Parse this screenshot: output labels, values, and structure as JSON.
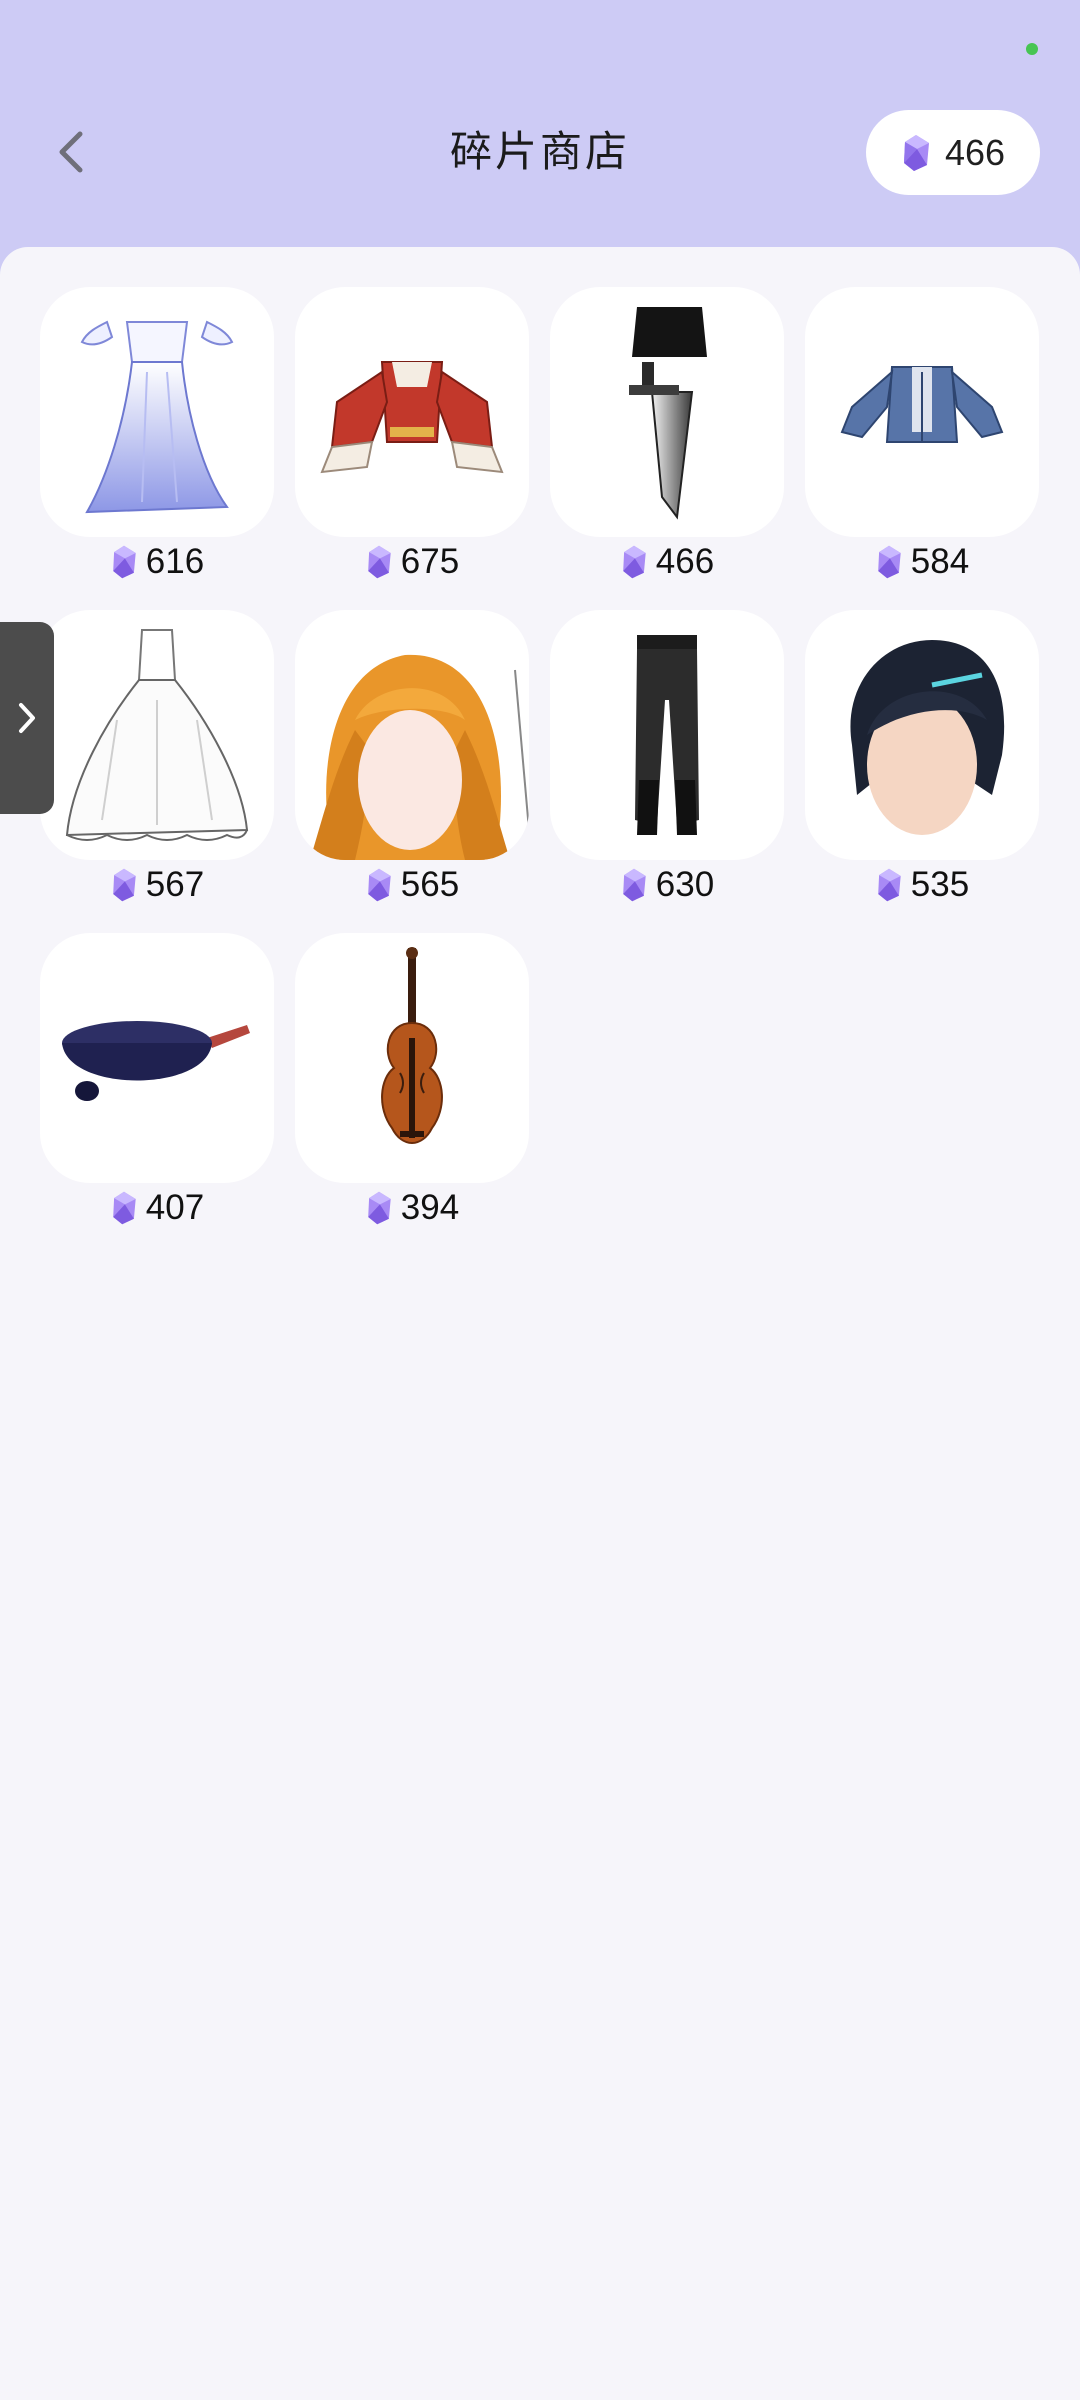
{
  "header": {
    "title": "碎片商店",
    "back_icon": "chevron-left-icon",
    "balance": {
      "icon": "crystal-icon",
      "amount": "466"
    }
  },
  "colors": {
    "header_bg": "#cdcbf5",
    "content_bg": "#f6f5fa",
    "crystal": "#9b7cf0",
    "status_dot": "#46c553"
  },
  "currency_icon": "crystal-icon",
  "items": [
    {
      "name": "white-blue-gown",
      "price": "616"
    },
    {
      "name": "red-white-top",
      "price": "675"
    },
    {
      "name": "black-skirt-with-blade",
      "price": "466"
    },
    {
      "name": "denim-jacket",
      "price": "584"
    },
    {
      "name": "white-wedding-dress",
      "price": "567"
    },
    {
      "name": "orange-long-hair",
      "price": "565"
    },
    {
      "name": "black-trousers",
      "price": "630"
    },
    {
      "name": "dark-swept-hair",
      "price": "535"
    },
    {
      "name": "navy-frying-pan",
      "price": "407"
    },
    {
      "name": "violin",
      "price": "394"
    }
  ],
  "side_tab": {
    "icon": "chevron-right-icon"
  }
}
